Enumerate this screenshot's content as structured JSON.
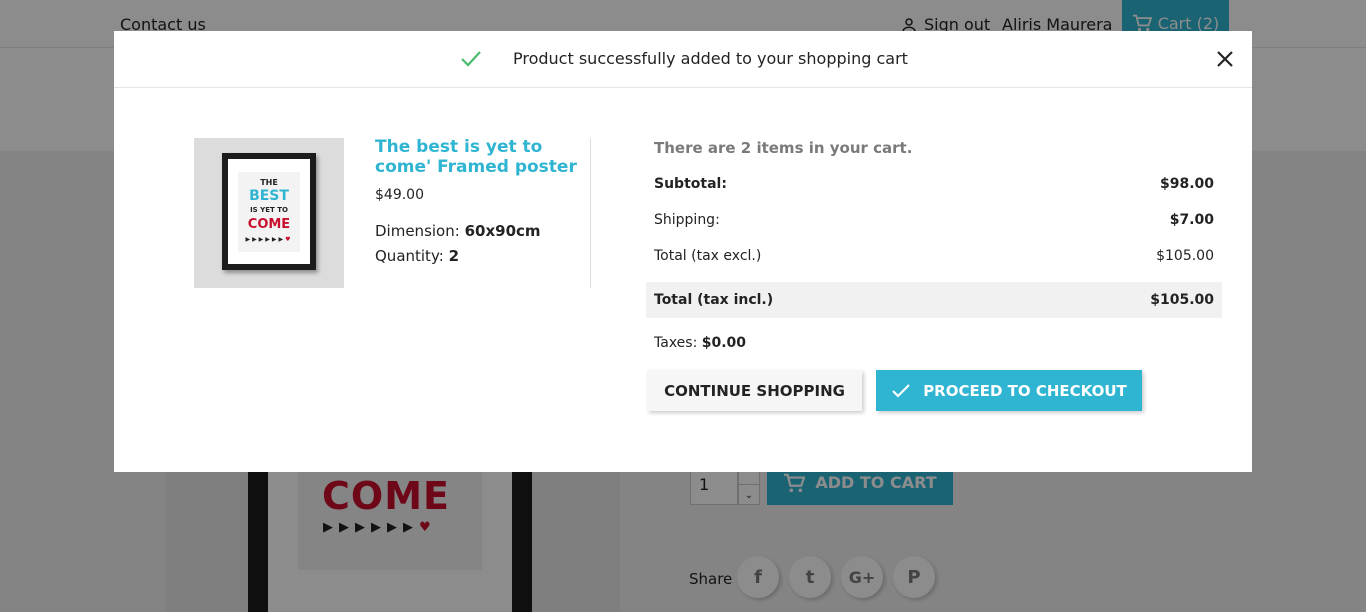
{
  "background": {
    "header": {
      "contact_link": "Contact us",
      "sign_out": "Sign out",
      "user_name": "Aliris Maurera",
      "cart_label": "Cart (2)"
    },
    "product": {
      "poster_word": "COME",
      "poster_arrows": "▶▶▶▶▶▶",
      "poster_heart": "♥",
      "quantity_value": "1",
      "add_to_cart_label": "ADD TO CART",
      "share_label": "Share",
      "share_icons": [
        {
          "name": "facebook-icon",
          "glyph": "f"
        },
        {
          "name": "twitter-icon",
          "glyph": "t"
        },
        {
          "name": "google-plus-icon",
          "glyph": "G+"
        },
        {
          "name": "pinterest-icon",
          "glyph": "P"
        }
      ]
    }
  },
  "modal": {
    "title": "Product successfully added to your shopping cart",
    "close_glyph": "✕",
    "product": {
      "name": "The best is yet to come' Framed poster",
      "price": "$49.00",
      "thumb_lines": [
        "THE",
        "BEST",
        "IS YET TO",
        "COME"
      ],
      "dimension_label": "Dimension:",
      "dimension_value": "60x90cm",
      "quantity_label": "Quantity:",
      "quantity_value": "2"
    },
    "summary": {
      "count_text": "There are 2 items in your cart.",
      "rows": [
        {
          "label": "Subtotal:",
          "value": "$98.00"
        },
        {
          "label": "Shipping:",
          "value": "$7.00"
        },
        {
          "label": "Total (tax excl.)",
          "value": "$105.00"
        },
        {
          "label": "Total (tax incl.)",
          "value": "$105.00"
        }
      ],
      "taxes_label": "Taxes:",
      "taxes_value": "$0.00"
    },
    "buttons": {
      "continue_label": "CONTINUE SHOPPING",
      "checkout_label": "PROCEED TO CHECKOUT"
    }
  },
  "colors": {
    "accent": "#2fb5d2",
    "success": "#4cbb6c",
    "poster_red": "#c8102e"
  }
}
